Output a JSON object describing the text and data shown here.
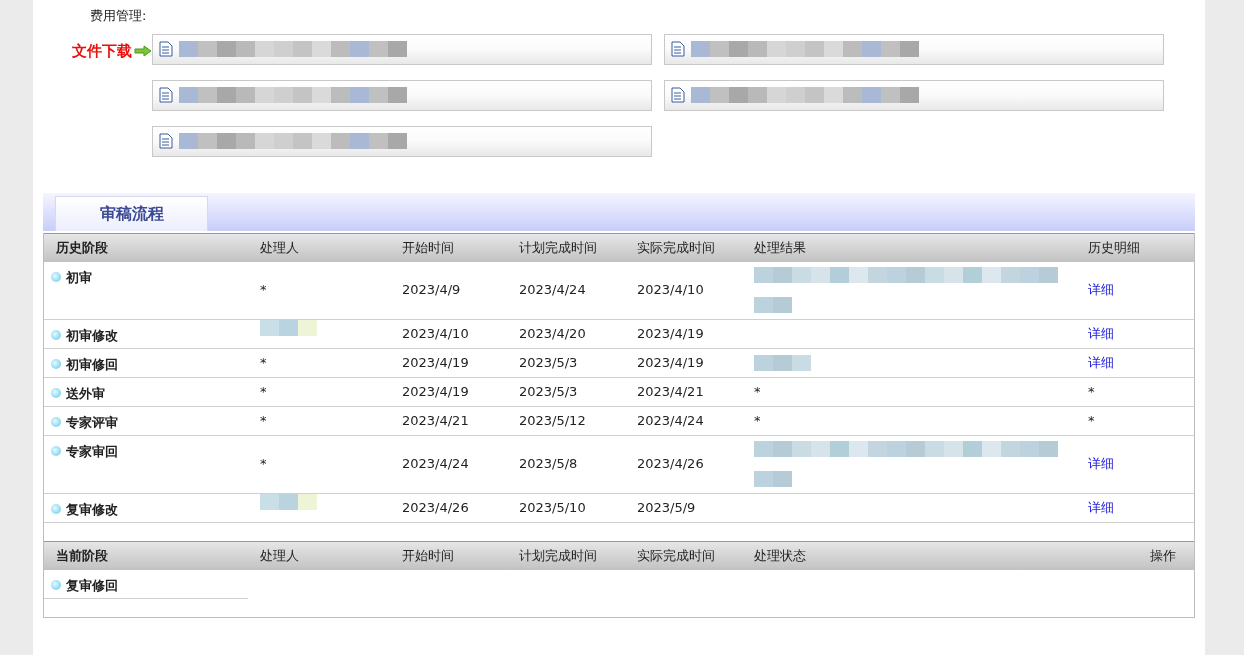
{
  "section_label": "费用管理:",
  "download": {
    "label": "文件下载",
    "files": [
      {
        "blurred": true
      },
      {
        "blurred": true
      },
      {
        "blurred": true
      },
      {
        "blurred": true
      },
      {
        "blurred": true
      }
    ]
  },
  "tabs": [
    {
      "label": "审稿流程",
      "selected": true
    }
  ],
  "history": {
    "columns": [
      "历史阶段",
      "处理人",
      "开始时间",
      "计划完成时间",
      "实际完成时间",
      "处理结果",
      "历史明细"
    ],
    "rows": [
      {
        "stage": "初审",
        "handler": "*",
        "start": "2023/4/9",
        "planned": "2023/4/24",
        "actual": "2023/4/10",
        "result_blurred": true,
        "result_wraps": true,
        "detail": "详细",
        "detail_link": true
      },
      {
        "stage": "初审修改",
        "handler_blurred": true,
        "start": "2023/4/10",
        "planned": "2023/4/20",
        "actual": "2023/4/19",
        "detail": "详细",
        "detail_link": true
      },
      {
        "stage": "初审修回",
        "handler": "*",
        "start": "2023/4/19",
        "planned": "2023/5/3",
        "actual": "2023/4/19",
        "result_blurred": true,
        "result_wraps": false,
        "detail": "详细",
        "detail_link": true
      },
      {
        "stage": "送外审",
        "handler": "*",
        "start": "2023/4/19",
        "planned": "2023/5/3",
        "actual": "2023/4/21",
        "result": "*",
        "detail": "*",
        "detail_link": false
      },
      {
        "stage": "专家评审",
        "handler": "*",
        "start": "2023/4/21",
        "planned": "2023/5/12",
        "actual": "2023/4/24",
        "result": "*",
        "detail": "*",
        "detail_link": false
      },
      {
        "stage": "专家审回",
        "handler": "*",
        "start": "2023/4/24",
        "planned": "2023/5/8",
        "actual": "2023/4/26",
        "result_blurred": true,
        "result_wraps": true,
        "detail": "详细",
        "detail_link": true
      },
      {
        "stage": "复审修改",
        "handler_blurred": true,
        "start": "2023/4/26",
        "planned": "2023/5/10",
        "actual": "2023/5/9",
        "detail": "详细",
        "detail_link": true
      }
    ]
  },
  "current": {
    "columns": [
      "当前阶段",
      "处理人",
      "开始时间",
      "计划完成时间",
      "实际完成时间",
      "处理状态",
      "操作"
    ],
    "rows": [
      {
        "stage": "复审修回"
      }
    ]
  }
}
